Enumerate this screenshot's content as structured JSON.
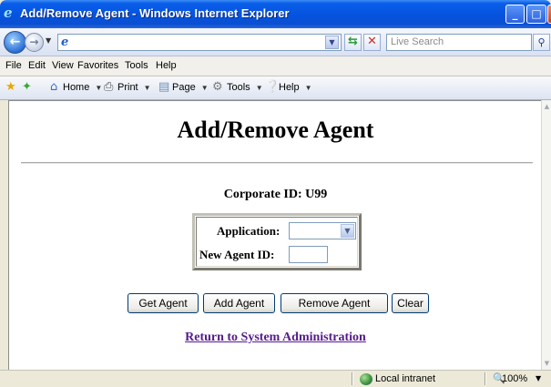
{
  "window": {
    "title": "Add/Remove Agent - Windows Internet Explorer",
    "minimize": "_",
    "maximize": "□",
    "close": "X"
  },
  "address_bar": {
    "search_placeholder": "Live Search"
  },
  "menu": {
    "items": [
      "File",
      "Edit",
      "View",
      "Favorites",
      "Tools",
      "Help"
    ]
  },
  "command_bar": {
    "home": "Home",
    "print": "Print",
    "page": "Page",
    "tools": "Tools",
    "help": "Help"
  },
  "page": {
    "title": "Add/Remove Agent",
    "corporate_id": "Corporate ID: U99",
    "form": {
      "application_label": "Application:",
      "application_value": "",
      "new_agent_label": "New Agent ID:",
      "new_agent_value": ""
    },
    "buttons": {
      "get_agent": "Get Agent",
      "add_agent": "Add Agent",
      "remove_agent": "Remove Agent",
      "clear": "Clear"
    },
    "return_link": "Return to System Administration"
  },
  "status_bar": {
    "zone": "Local intranet",
    "zoom": "100%"
  },
  "colors": {
    "titlebar": "#0553de",
    "visited_link": "#551a8b"
  }
}
